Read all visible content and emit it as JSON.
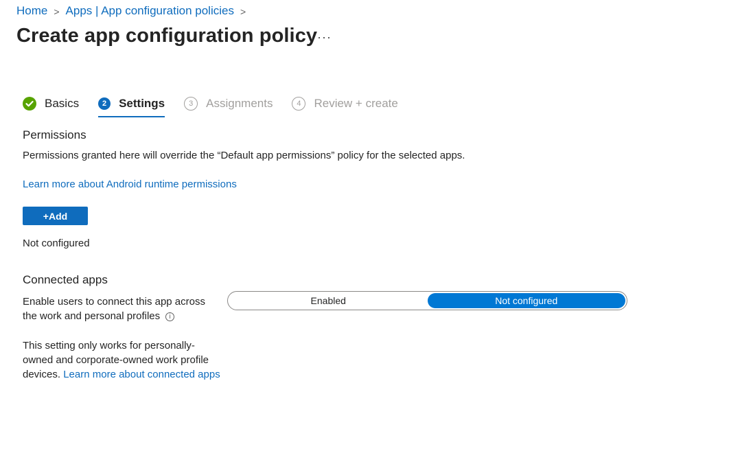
{
  "breadcrumb": {
    "home": "Home",
    "parent": "Apps | App configuration policies",
    "separator": ">"
  },
  "page": {
    "title": "Create app configuration policy",
    "more": "···"
  },
  "wizard": {
    "steps": [
      {
        "num": "✓",
        "label": "Basics",
        "state": "done"
      },
      {
        "num": "2",
        "label": "Settings",
        "state": "current"
      },
      {
        "num": "3",
        "label": "Assignments",
        "state": "todo"
      },
      {
        "num": "4",
        "label": "Review + create",
        "state": "todo"
      }
    ]
  },
  "permissions": {
    "title": "Permissions",
    "description": "Permissions granted here will override the “Default app permissions” policy for the selected apps.",
    "learn_more": "Learn more about Android runtime permissions",
    "add_label": "+Add",
    "status": "Not configured"
  },
  "connected_apps": {
    "title": "Connected apps",
    "setting_line1": "Enable users to connect this app across",
    "setting_line2": "the work and personal profiles",
    "info_icon": "i",
    "note_line1": "This setting only works for personally-",
    "note_line2": "owned and corporate-owned work profile",
    "note_line3_prefix": "devices. ",
    "note_link": "Learn more about connected apps",
    "toggle": {
      "option1": "Enabled",
      "option2": "Not configured",
      "selected": "Not configured"
    }
  },
  "colors": {
    "accent": "#0f6cbd",
    "toggle_selected": "#0078d4",
    "done_green": "#57a300"
  }
}
